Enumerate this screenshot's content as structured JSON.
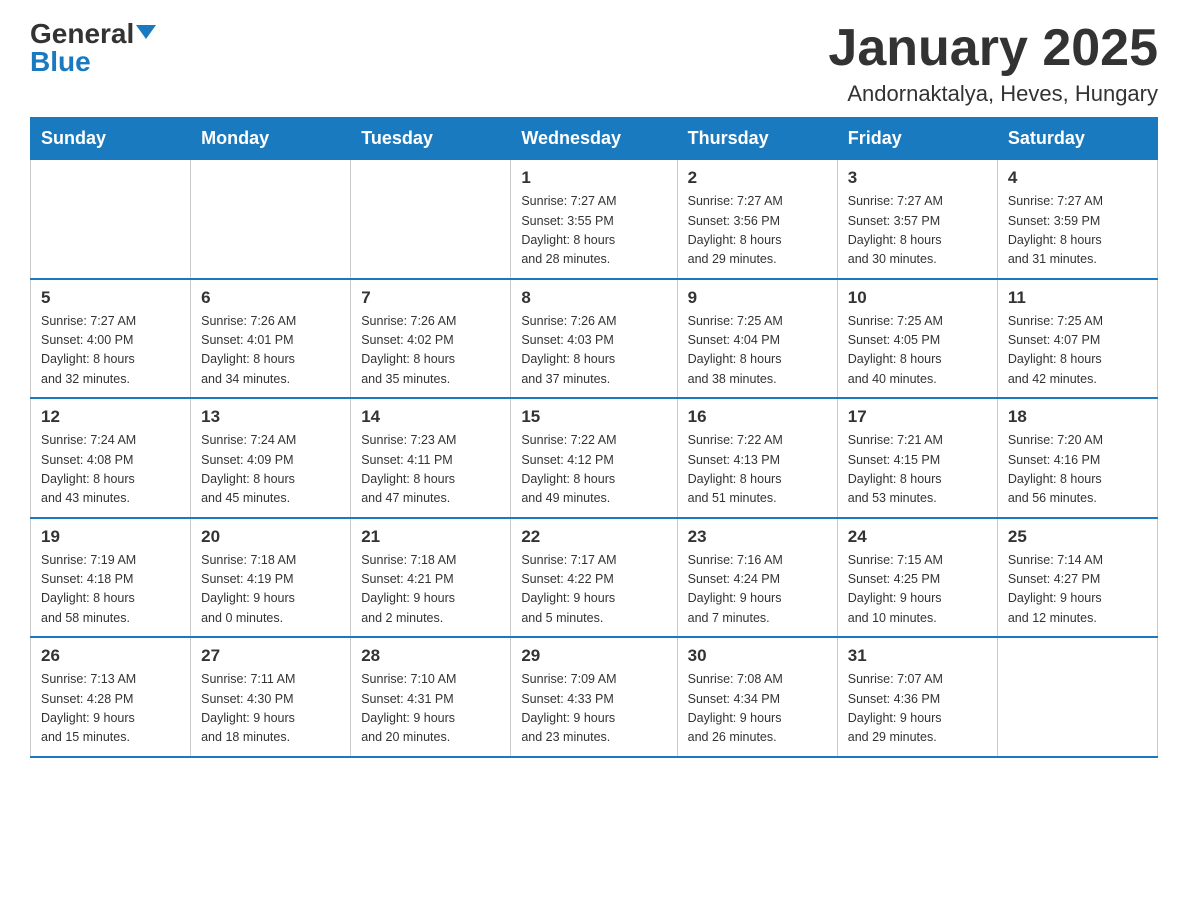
{
  "header": {
    "logo_general": "General",
    "logo_blue": "Blue",
    "title": "January 2025",
    "subtitle": "Andornaktalya, Heves, Hungary"
  },
  "days_of_week": [
    "Sunday",
    "Monday",
    "Tuesday",
    "Wednesday",
    "Thursday",
    "Friday",
    "Saturday"
  ],
  "weeks": [
    [
      {
        "day": "",
        "info": ""
      },
      {
        "day": "",
        "info": ""
      },
      {
        "day": "",
        "info": ""
      },
      {
        "day": "1",
        "info": "Sunrise: 7:27 AM\nSunset: 3:55 PM\nDaylight: 8 hours\nand 28 minutes."
      },
      {
        "day": "2",
        "info": "Sunrise: 7:27 AM\nSunset: 3:56 PM\nDaylight: 8 hours\nand 29 minutes."
      },
      {
        "day": "3",
        "info": "Sunrise: 7:27 AM\nSunset: 3:57 PM\nDaylight: 8 hours\nand 30 minutes."
      },
      {
        "day": "4",
        "info": "Sunrise: 7:27 AM\nSunset: 3:59 PM\nDaylight: 8 hours\nand 31 minutes."
      }
    ],
    [
      {
        "day": "5",
        "info": "Sunrise: 7:27 AM\nSunset: 4:00 PM\nDaylight: 8 hours\nand 32 minutes."
      },
      {
        "day": "6",
        "info": "Sunrise: 7:26 AM\nSunset: 4:01 PM\nDaylight: 8 hours\nand 34 minutes."
      },
      {
        "day": "7",
        "info": "Sunrise: 7:26 AM\nSunset: 4:02 PM\nDaylight: 8 hours\nand 35 minutes."
      },
      {
        "day": "8",
        "info": "Sunrise: 7:26 AM\nSunset: 4:03 PM\nDaylight: 8 hours\nand 37 minutes."
      },
      {
        "day": "9",
        "info": "Sunrise: 7:25 AM\nSunset: 4:04 PM\nDaylight: 8 hours\nand 38 minutes."
      },
      {
        "day": "10",
        "info": "Sunrise: 7:25 AM\nSunset: 4:05 PM\nDaylight: 8 hours\nand 40 minutes."
      },
      {
        "day": "11",
        "info": "Sunrise: 7:25 AM\nSunset: 4:07 PM\nDaylight: 8 hours\nand 42 minutes."
      }
    ],
    [
      {
        "day": "12",
        "info": "Sunrise: 7:24 AM\nSunset: 4:08 PM\nDaylight: 8 hours\nand 43 minutes."
      },
      {
        "day": "13",
        "info": "Sunrise: 7:24 AM\nSunset: 4:09 PM\nDaylight: 8 hours\nand 45 minutes."
      },
      {
        "day": "14",
        "info": "Sunrise: 7:23 AM\nSunset: 4:11 PM\nDaylight: 8 hours\nand 47 minutes."
      },
      {
        "day": "15",
        "info": "Sunrise: 7:22 AM\nSunset: 4:12 PM\nDaylight: 8 hours\nand 49 minutes."
      },
      {
        "day": "16",
        "info": "Sunrise: 7:22 AM\nSunset: 4:13 PM\nDaylight: 8 hours\nand 51 minutes."
      },
      {
        "day": "17",
        "info": "Sunrise: 7:21 AM\nSunset: 4:15 PM\nDaylight: 8 hours\nand 53 minutes."
      },
      {
        "day": "18",
        "info": "Sunrise: 7:20 AM\nSunset: 4:16 PM\nDaylight: 8 hours\nand 56 minutes."
      }
    ],
    [
      {
        "day": "19",
        "info": "Sunrise: 7:19 AM\nSunset: 4:18 PM\nDaylight: 8 hours\nand 58 minutes."
      },
      {
        "day": "20",
        "info": "Sunrise: 7:18 AM\nSunset: 4:19 PM\nDaylight: 9 hours\nand 0 minutes."
      },
      {
        "day": "21",
        "info": "Sunrise: 7:18 AM\nSunset: 4:21 PM\nDaylight: 9 hours\nand 2 minutes."
      },
      {
        "day": "22",
        "info": "Sunrise: 7:17 AM\nSunset: 4:22 PM\nDaylight: 9 hours\nand 5 minutes."
      },
      {
        "day": "23",
        "info": "Sunrise: 7:16 AM\nSunset: 4:24 PM\nDaylight: 9 hours\nand 7 minutes."
      },
      {
        "day": "24",
        "info": "Sunrise: 7:15 AM\nSunset: 4:25 PM\nDaylight: 9 hours\nand 10 minutes."
      },
      {
        "day": "25",
        "info": "Sunrise: 7:14 AM\nSunset: 4:27 PM\nDaylight: 9 hours\nand 12 minutes."
      }
    ],
    [
      {
        "day": "26",
        "info": "Sunrise: 7:13 AM\nSunset: 4:28 PM\nDaylight: 9 hours\nand 15 minutes."
      },
      {
        "day": "27",
        "info": "Sunrise: 7:11 AM\nSunset: 4:30 PM\nDaylight: 9 hours\nand 18 minutes."
      },
      {
        "day": "28",
        "info": "Sunrise: 7:10 AM\nSunset: 4:31 PM\nDaylight: 9 hours\nand 20 minutes."
      },
      {
        "day": "29",
        "info": "Sunrise: 7:09 AM\nSunset: 4:33 PM\nDaylight: 9 hours\nand 23 minutes."
      },
      {
        "day": "30",
        "info": "Sunrise: 7:08 AM\nSunset: 4:34 PM\nDaylight: 9 hours\nand 26 minutes."
      },
      {
        "day": "31",
        "info": "Sunrise: 7:07 AM\nSunset: 4:36 PM\nDaylight: 9 hours\nand 29 minutes."
      },
      {
        "day": "",
        "info": ""
      }
    ]
  ]
}
